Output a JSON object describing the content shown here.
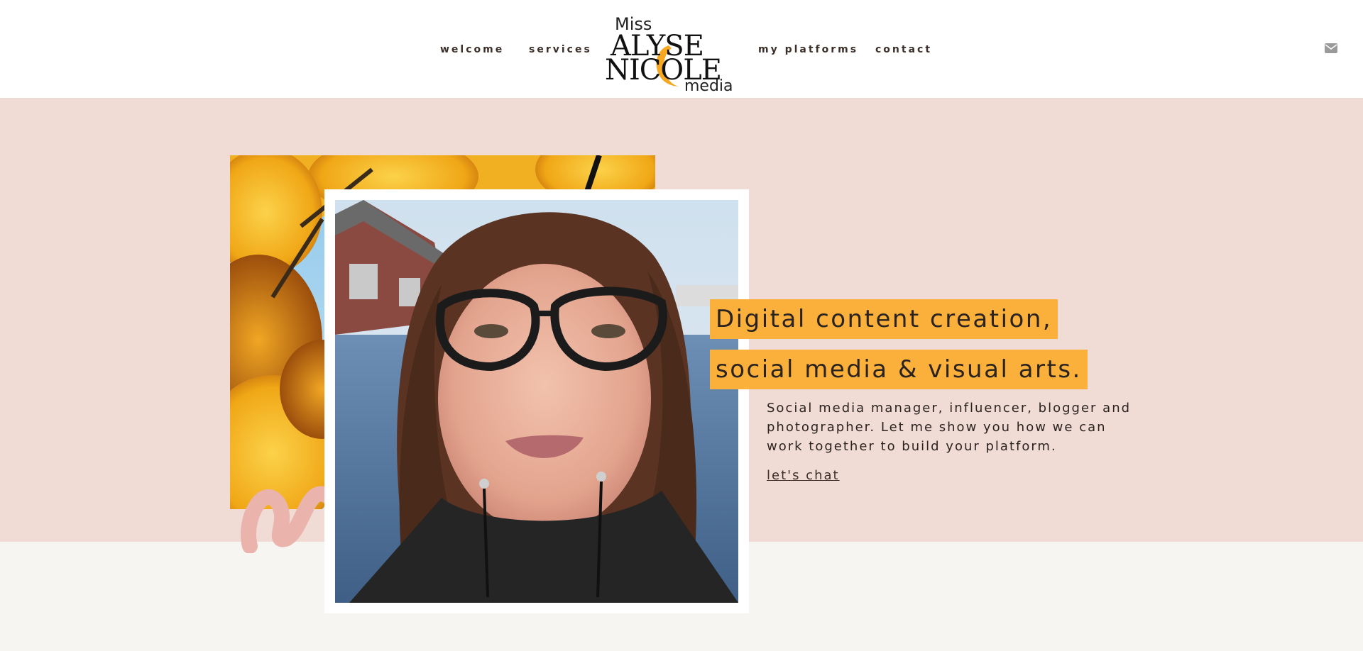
{
  "header": {
    "nav_left": [
      {
        "label": "welcome"
      },
      {
        "label": "services"
      }
    ],
    "nav_right": [
      {
        "label": "my platforms"
      },
      {
        "label": "contact"
      }
    ],
    "logo": {
      "line1": "Miss",
      "line2": "ALYSE",
      "line3": "NICOLE",
      "line4": "media"
    },
    "mail_icon": "envelope-icon"
  },
  "hero": {
    "headline_line1": "Digital content creation,",
    "headline_line2": "social media & visual arts.",
    "body": "Social media manager, influencer, blogger and photographer. Let me show you how we can work together to build your platform.",
    "cta": "let's chat"
  },
  "colors": {
    "header_bg": "#ffffff",
    "hero_bg": "#f1dbd5",
    "lower_bg": "#f6f5f1",
    "accent": "#fbb03b",
    "text": "#2b2320"
  }
}
